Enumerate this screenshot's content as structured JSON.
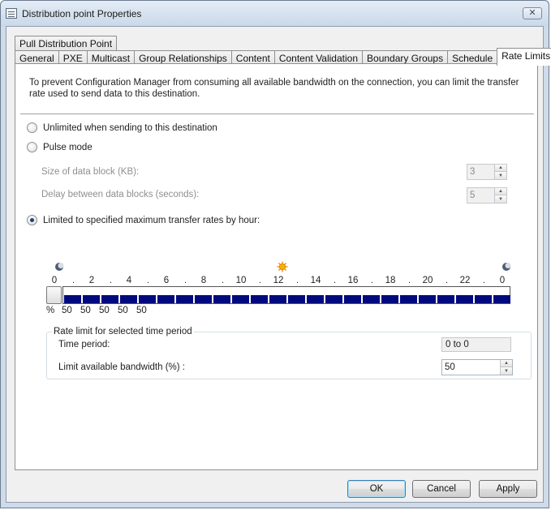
{
  "window": {
    "title": "Distribution point Properties",
    "close_glyph": "✕"
  },
  "tabs": {
    "top_row": [
      "Pull Distribution Point"
    ],
    "bottom_row": [
      "General",
      "PXE",
      "Multicast",
      "Group Relationships",
      "Content",
      "Content Validation",
      "Boundary Groups",
      "Schedule",
      "Rate Limits"
    ],
    "active": "Rate Limits"
  },
  "rate_limits": {
    "intro": "To prevent Configuration Manager from consuming all available bandwidth on the connection, you can  limit the transfer rate used to send data to this destination.",
    "options": {
      "unlimited": "Unlimited when sending to this destination",
      "pulse": "Pulse mode",
      "limited": "Limited to specified maximum transfer rates by hour:"
    },
    "selected_option": "limited",
    "pulse_settings": {
      "block_size_label": "Size of data block (KB):",
      "block_size_value": "3",
      "delay_label": "Delay between data blocks (seconds):",
      "delay_value": "5"
    },
    "schedule": {
      "hour_labels": [
        "0",
        "2",
        "4",
        "6",
        "8",
        "10",
        "12",
        "14",
        "16",
        "18",
        "20",
        "22",
        "0"
      ],
      "percent_label": "%",
      "visible_percent_values": [
        "50",
        "50",
        "50",
        "50",
        "50"
      ],
      "start_icon": "moon-icon",
      "noon_icon": "sun-icon",
      "end_icon": "moon-icon"
    },
    "period_group": {
      "title": "Rate limit for selected time period",
      "time_period_label": "Time period:",
      "time_period_value": "0 to 0",
      "bandwidth_label": "Limit available bandwidth (%) :",
      "bandwidth_value": "50"
    }
  },
  "buttons": {
    "ok": "OK",
    "cancel": "Cancel",
    "apply": "Apply"
  },
  "colors": {
    "schedule_fill": "#000a7d",
    "title_bar": "#cfdbe9",
    "default_button_border": "#3c7fb1"
  }
}
